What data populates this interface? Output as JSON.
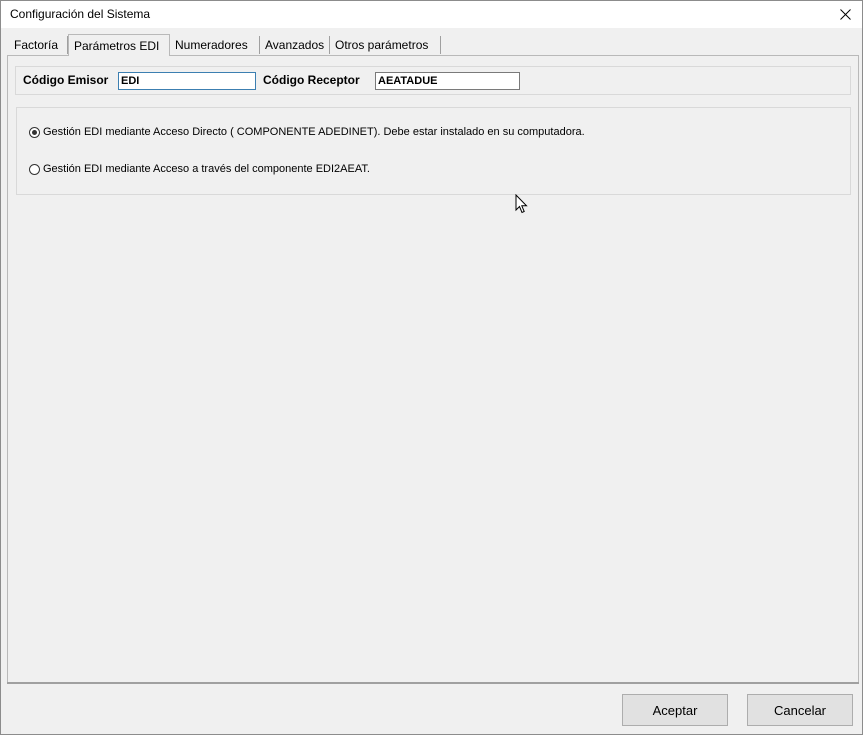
{
  "window": {
    "title": "Configuración del Sistema"
  },
  "tabs": [
    {
      "label": "Factoría",
      "active": false
    },
    {
      "label": "Parámetros EDI",
      "active": true
    },
    {
      "label": "Numeradores",
      "active": false
    },
    {
      "label": "Avanzados",
      "active": false
    },
    {
      "label": "Otros parámetros",
      "active": false
    }
  ],
  "codes": {
    "emisor_label": "Código Emisor",
    "emisor_value": "EDI",
    "receptor_label": "Código Receptor",
    "receptor_value": "AEATADUE"
  },
  "options": [
    {
      "label": "Gestión EDI mediante Acceso Directo ( COMPONENTE ADEDINET). Debe estar instalado en su computadora.",
      "checked": true
    },
    {
      "label": "Gestión EDI mediante Acceso a través del componente EDI2AEAT.",
      "checked": false
    }
  ],
  "buttons": {
    "accept": "Aceptar",
    "cancel": "Cancelar"
  },
  "icons": {
    "close": "close-icon",
    "cursor": "mouse-pointer-icon"
  }
}
